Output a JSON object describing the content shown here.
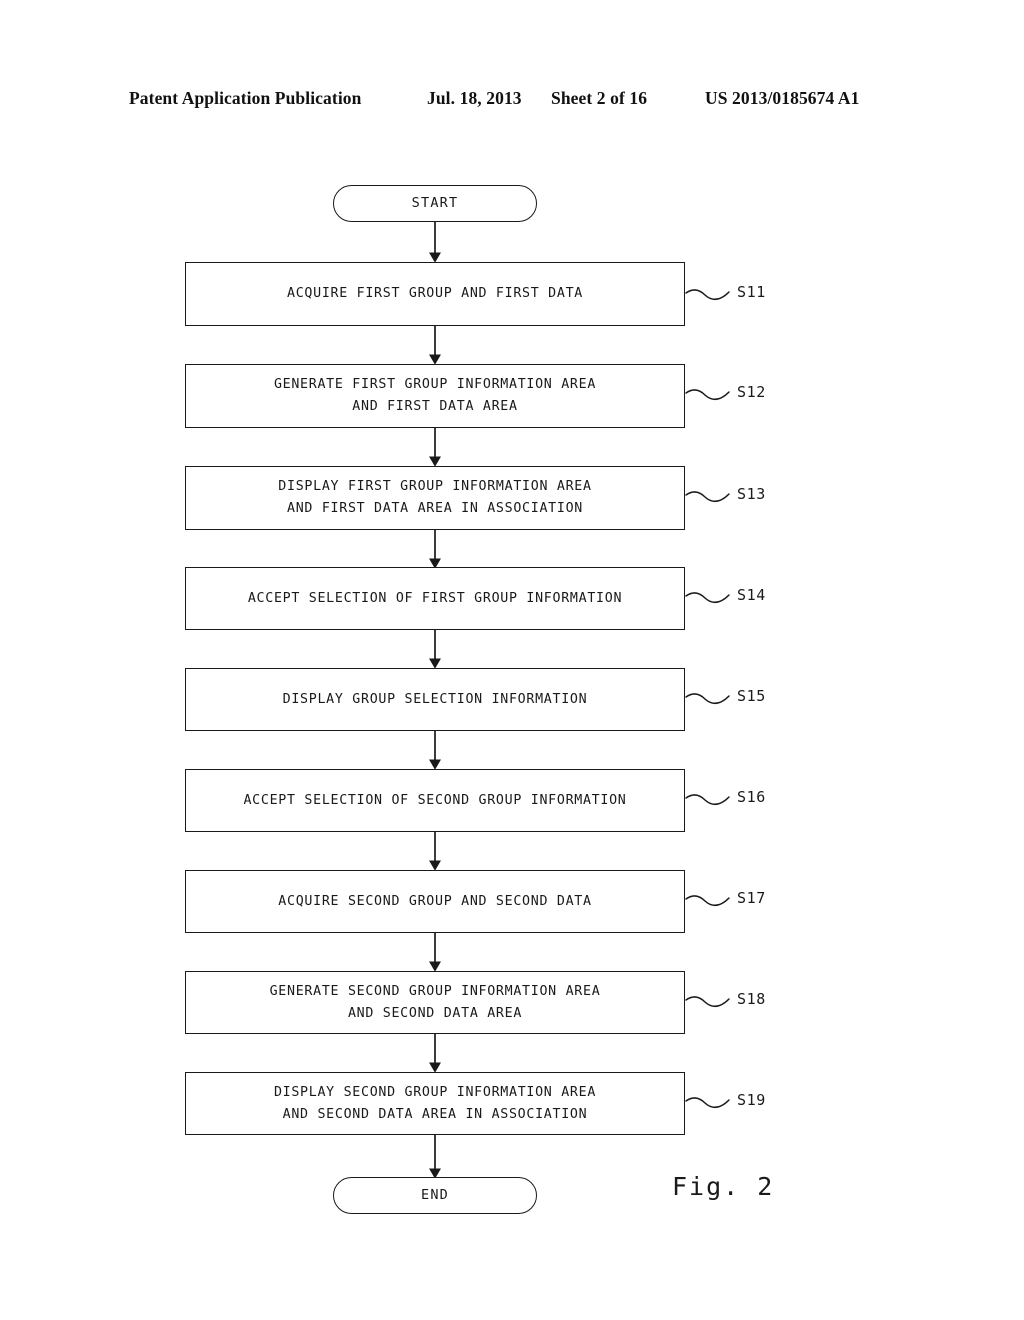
{
  "header": {
    "publication": "Patent Application Publication",
    "date": "Jul. 18, 2013",
    "sheet": "Sheet 2 of 16",
    "patent_number": "US 2013/0185674 A1"
  },
  "figure": {
    "caption": "Fig. 2",
    "type": "flowchart",
    "start_label": "START",
    "end_label": "END",
    "ink_color": "#1a1a1a",
    "background_color": "#ffffff",
    "steps": [
      {
        "ref": "S11",
        "text": "ACQUIRE FIRST GROUP AND FIRST DATA",
        "lines": 1
      },
      {
        "ref": "S12",
        "text": "GENERATE FIRST GROUP INFORMATION AREA\nAND FIRST DATA AREA",
        "lines": 2
      },
      {
        "ref": "S13",
        "text": "DISPLAY FIRST GROUP INFORMATION AREA\nAND FIRST DATA AREA IN ASSOCIATION",
        "lines": 2
      },
      {
        "ref": "S14",
        "text": "ACCEPT SELECTION OF FIRST GROUP INFORMATION",
        "lines": 1
      },
      {
        "ref": "S15",
        "text": "DISPLAY GROUP SELECTION INFORMATION",
        "lines": 1
      },
      {
        "ref": "S16",
        "text": "ACCEPT SELECTION OF SECOND GROUP INFORMATION",
        "lines": 1
      },
      {
        "ref": "S17",
        "text": "ACQUIRE SECOND GROUP AND SECOND DATA",
        "lines": 1
      },
      {
        "ref": "S18",
        "text": "GENERATE SECOND GROUP INFORMATION AREA\nAND SECOND DATA AREA",
        "lines": 2
      },
      {
        "ref": "S19",
        "text": "DISPLAY SECOND GROUP INFORMATION AREA\nAND SECOND DATA AREA IN ASSOCIATION",
        "lines": 2
      }
    ]
  }
}
